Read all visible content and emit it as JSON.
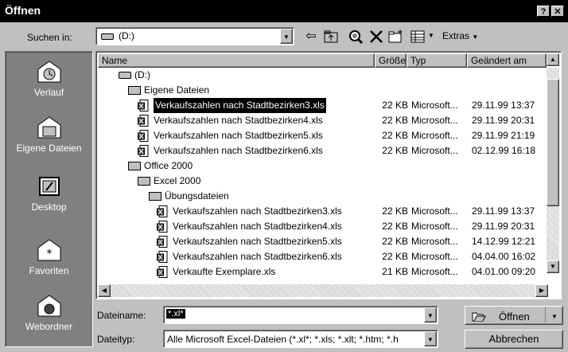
{
  "window": {
    "title": "Öffnen",
    "help_btn": "?",
    "close_btn": "✕"
  },
  "toolbar": {
    "lookin_label": "Suchen in:",
    "lookin_value": "(D:)",
    "back_icon": "⇦",
    "extras_label": "Extras"
  },
  "places": [
    {
      "label": "Verlauf",
      "icon": "history-icon"
    },
    {
      "label": "Eigene Dateien",
      "icon": "my-documents-icon"
    },
    {
      "label": "Desktop",
      "icon": "desktop-icon"
    },
    {
      "label": "Favoriten",
      "icon": "favorites-icon"
    },
    {
      "label": "Webordner",
      "icon": "web-folders-icon"
    }
  ],
  "columns": {
    "name": "Name",
    "size": "Größe",
    "type": "Typ",
    "modified": "Geändert am"
  },
  "rows": [
    {
      "kind": "drive",
      "indent": 0,
      "name": "(D:)",
      "size": "",
      "type": "",
      "modified": ""
    },
    {
      "kind": "folder",
      "indent": 1,
      "name": "Eigene Dateien",
      "size": "",
      "type": "",
      "modified": ""
    },
    {
      "kind": "file",
      "indent": 2,
      "name": "Verkaufszahlen nach Stadtbezirken3.xls",
      "size": "22 KB",
      "type": "Microsoft...",
      "modified": "29.11.99 13:37",
      "selected": true
    },
    {
      "kind": "file",
      "indent": 2,
      "name": "Verkaufszahlen nach Stadtbezirken4.xls",
      "size": "22 KB",
      "type": "Microsoft...",
      "modified": "29.11.99 20:31"
    },
    {
      "kind": "file",
      "indent": 2,
      "name": "Verkaufszahlen nach Stadtbezirken5.xls",
      "size": "22 KB",
      "type": "Microsoft...",
      "modified": "29.11.99 21:19"
    },
    {
      "kind": "file",
      "indent": 2,
      "name": "Verkaufszahlen nach Stadtbezirken6.xls",
      "size": "22 KB",
      "type": "Microsoft...",
      "modified": "02.12.99 16:18"
    },
    {
      "kind": "folder",
      "indent": 1,
      "name": "Office 2000",
      "size": "",
      "type": "",
      "modified": ""
    },
    {
      "kind": "folder",
      "indent": 2,
      "name": "Excel 2000",
      "size": "",
      "type": "",
      "modified": ""
    },
    {
      "kind": "folder",
      "indent": 3,
      "name": "Übungsdateien",
      "size": "",
      "type": "",
      "modified": ""
    },
    {
      "kind": "file",
      "indent": 4,
      "name": "Verkaufszahlen nach Stadtbezirken3.xls",
      "size": "22 KB",
      "type": "Microsoft...",
      "modified": "29.11.99 13:37"
    },
    {
      "kind": "file",
      "indent": 4,
      "name": "Verkaufszahlen nach Stadtbezirken4.xls",
      "size": "22 KB",
      "type": "Microsoft...",
      "modified": "29.11.99 20:31"
    },
    {
      "kind": "file",
      "indent": 4,
      "name": "Verkaufszahlen nach Stadtbezirken5.xls",
      "size": "22 KB",
      "type": "Microsoft...",
      "modified": "14.12.99 12:21"
    },
    {
      "kind": "file",
      "indent": 4,
      "name": "Verkaufszahlen nach Stadtbezirken6.xls",
      "size": "22 KB",
      "type": "Microsoft...",
      "modified": "04.04.00 16:02"
    },
    {
      "kind": "file",
      "indent": 4,
      "name": "Verkaufte Exemplare.xls",
      "size": "21 KB",
      "type": "Microsoft...",
      "modified": "04.01.00 09:20"
    }
  ],
  "footer": {
    "filename_label": "Dateiname:",
    "filename_value": "*.xl*",
    "filetype_label": "Dateityp:",
    "filetype_value": "Alle Microsoft Excel-Dateien (*.xl*; *.xls; *.xlt; *.htm; *.h",
    "open_label": "Öffnen",
    "cancel_label": "Abbrechen"
  }
}
